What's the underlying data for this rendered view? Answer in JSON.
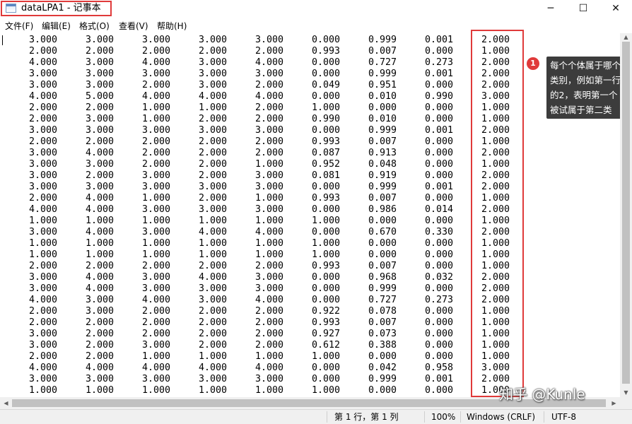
{
  "window": {
    "title": "dataLPA1 - 记事本",
    "minimize_glyph": "─",
    "maximize_glyph": "☐",
    "close_glyph": "✕",
    "icon": "notepad-icon"
  },
  "menu": [
    "文件(F)",
    "编辑(E)",
    "格式(O)",
    "查看(V)",
    "帮助(H)"
  ],
  "data_rows": [
    [
      "3.000",
      "3.000",
      "3.000",
      "3.000",
      "3.000",
      "0.000",
      "0.999",
      "0.001",
      "2.000"
    ],
    [
      "2.000",
      "2.000",
      "2.000",
      "2.000",
      "2.000",
      "0.993",
      "0.007",
      "0.000",
      "1.000"
    ],
    [
      "4.000",
      "3.000",
      "4.000",
      "3.000",
      "4.000",
      "0.000",
      "0.727",
      "0.273",
      "2.000"
    ],
    [
      "3.000",
      "3.000",
      "3.000",
      "3.000",
      "3.000",
      "0.000",
      "0.999",
      "0.001",
      "2.000"
    ],
    [
      "3.000",
      "3.000",
      "2.000",
      "3.000",
      "2.000",
      "0.049",
      "0.951",
      "0.000",
      "2.000"
    ],
    [
      "4.000",
      "5.000",
      "4.000",
      "4.000",
      "4.000",
      "0.000",
      "0.010",
      "0.990",
      "3.000"
    ],
    [
      "2.000",
      "2.000",
      "1.000",
      "1.000",
      "2.000",
      "1.000",
      "0.000",
      "0.000",
      "1.000"
    ],
    [
      "2.000",
      "3.000",
      "1.000",
      "2.000",
      "2.000",
      "0.990",
      "0.010",
      "0.000",
      "1.000"
    ],
    [
      "3.000",
      "3.000",
      "3.000",
      "3.000",
      "3.000",
      "0.000",
      "0.999",
      "0.001",
      "2.000"
    ],
    [
      "2.000",
      "2.000",
      "2.000",
      "2.000",
      "2.000",
      "0.993",
      "0.007",
      "0.000",
      "1.000"
    ],
    [
      "3.000",
      "4.000",
      "2.000",
      "2.000",
      "2.000",
      "0.087",
      "0.913",
      "0.000",
      "2.000"
    ],
    [
      "3.000",
      "3.000",
      "2.000",
      "2.000",
      "1.000",
      "0.952",
      "0.048",
      "0.000",
      "1.000"
    ],
    [
      "3.000",
      "2.000",
      "3.000",
      "2.000",
      "3.000",
      "0.081",
      "0.919",
      "0.000",
      "2.000"
    ],
    [
      "3.000",
      "3.000",
      "3.000",
      "3.000",
      "3.000",
      "0.000",
      "0.999",
      "0.001",
      "2.000"
    ],
    [
      "2.000",
      "4.000",
      "1.000",
      "2.000",
      "1.000",
      "0.993",
      "0.007",
      "0.000",
      "1.000"
    ],
    [
      "4.000",
      "4.000",
      "3.000",
      "3.000",
      "3.000",
      "0.000",
      "0.986",
      "0.014",
      "2.000"
    ],
    [
      "1.000",
      "1.000",
      "1.000",
      "1.000",
      "1.000",
      "1.000",
      "0.000",
      "0.000",
      "1.000"
    ],
    [
      "3.000",
      "4.000",
      "3.000",
      "4.000",
      "4.000",
      "0.000",
      "0.670",
      "0.330",
      "2.000"
    ],
    [
      "1.000",
      "1.000",
      "1.000",
      "1.000",
      "1.000",
      "1.000",
      "0.000",
      "0.000",
      "1.000"
    ],
    [
      "1.000",
      "1.000",
      "1.000",
      "1.000",
      "1.000",
      "1.000",
      "0.000",
      "0.000",
      "1.000"
    ],
    [
      "2.000",
      "2.000",
      "2.000",
      "2.000",
      "2.000",
      "0.993",
      "0.007",
      "0.000",
      "1.000"
    ],
    [
      "3.000",
      "4.000",
      "3.000",
      "4.000",
      "3.000",
      "0.000",
      "0.968",
      "0.032",
      "2.000"
    ],
    [
      "3.000",
      "4.000",
      "3.000",
      "3.000",
      "3.000",
      "0.000",
      "0.999",
      "0.000",
      "2.000"
    ],
    [
      "4.000",
      "3.000",
      "4.000",
      "3.000",
      "4.000",
      "0.000",
      "0.727",
      "0.273",
      "2.000"
    ],
    [
      "2.000",
      "3.000",
      "2.000",
      "2.000",
      "2.000",
      "0.922",
      "0.078",
      "0.000",
      "1.000"
    ],
    [
      "2.000",
      "2.000",
      "2.000",
      "2.000",
      "2.000",
      "0.993",
      "0.007",
      "0.000",
      "1.000"
    ],
    [
      "3.000",
      "2.000",
      "2.000",
      "2.000",
      "2.000",
      "0.927",
      "0.073",
      "0.000",
      "1.000"
    ],
    [
      "3.000",
      "2.000",
      "3.000",
      "2.000",
      "2.000",
      "0.612",
      "0.388",
      "0.000",
      "1.000"
    ],
    [
      "2.000",
      "2.000",
      "1.000",
      "1.000",
      "1.000",
      "1.000",
      "0.000",
      "0.000",
      "1.000"
    ],
    [
      "4.000",
      "4.000",
      "4.000",
      "4.000",
      "4.000",
      "0.000",
      "0.042",
      "0.958",
      "3.000"
    ],
    [
      "3.000",
      "3.000",
      "3.000",
      "3.000",
      "3.000",
      "0.000",
      "0.999",
      "0.001",
      "2.000"
    ],
    [
      "1.000",
      "1.000",
      "1.000",
      "1.000",
      "1.000",
      "1.000",
      "0.000",
      "0.000",
      "1.000"
    ]
  ],
  "annotation": {
    "badge": "1",
    "lines": [
      "每个个体属于哪个",
      "类别，例如第一行",
      "的2，表明第一个",
      "被试属于第二类"
    ]
  },
  "statusbar": {
    "position": "第 1 行，第 1 列",
    "zoom": "100%",
    "line_ending": "Windows (CRLF)",
    "encoding": "UTF-8"
  },
  "watermark": "知乎 @Kunle",
  "colors": {
    "highlight": "#e03a3a",
    "callout_bg": "#3c3c3c"
  }
}
